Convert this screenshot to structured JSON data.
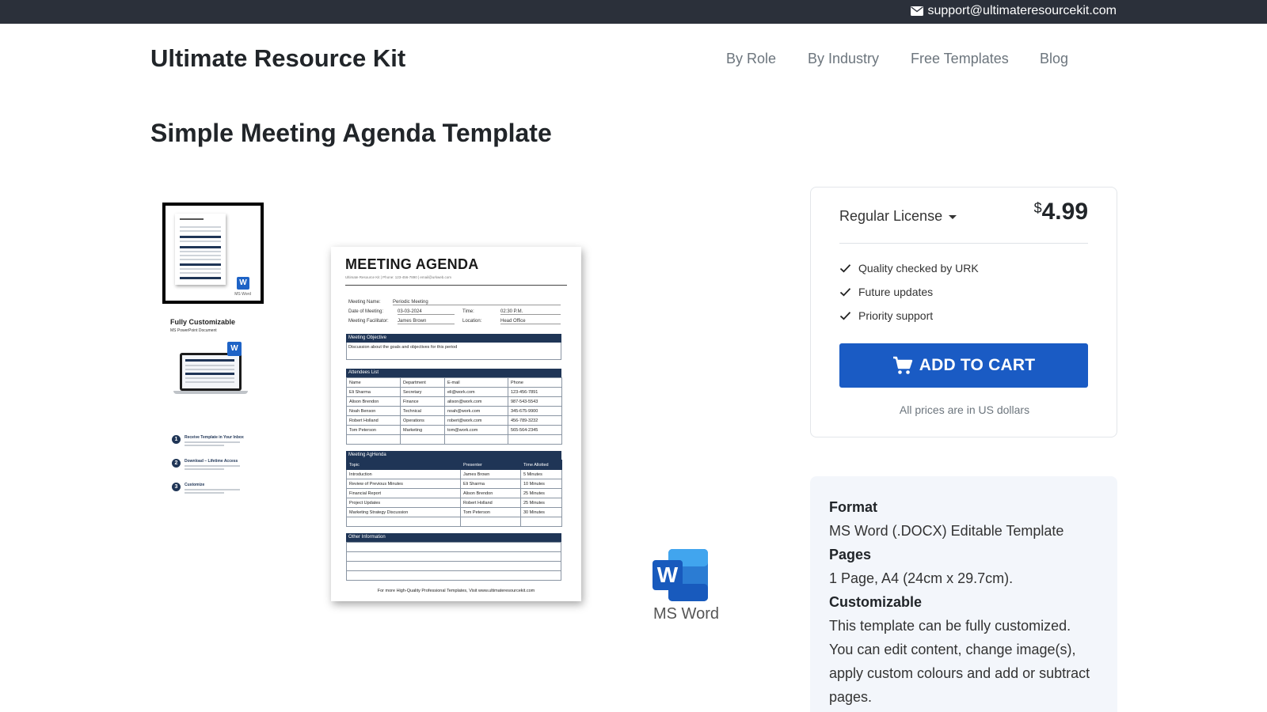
{
  "topbar": {
    "email": "support@ultimateresourcekit.com",
    "icon": "envelope-icon"
  },
  "header": {
    "brand": "Ultimate Resource Kit",
    "nav": [
      "By Role",
      "By Industry",
      "Free Templates",
      "Blog"
    ]
  },
  "page": {
    "title": "Simple Meeting Agenda Template"
  },
  "thumbnails": {
    "active_index": 0,
    "thumb2_title": "Fully Customizable",
    "thumb2_subtitle": "MS PowerPoint Document",
    "thumb1_word_label": "MS Word",
    "steps": [
      {
        "num": "1",
        "title": "Receive Template in Your Inbox"
      },
      {
        "num": "2",
        "title": "Download – Lifetime Access"
      },
      {
        "num": "3",
        "title": "Customize"
      }
    ]
  },
  "document": {
    "title": "MEETING AGENDA",
    "subtitle": "Ultimate Resource Kit | Phone: 123-456-7890 | email@urkweb.com",
    "info": {
      "name_label": "Meeting Name:",
      "name_value": "Periodic Meeting",
      "date_label": "Date of Meeting:",
      "date_value": "03-03-2024",
      "time_label": "Time:",
      "time_value": "02:30 P.M.",
      "facilitator_label": "Meeting Facilitator:",
      "facilitator_value": "James Brown",
      "location_label": "Location:",
      "location_value": "Head Office"
    },
    "objective": {
      "heading": "Meeting Objective",
      "text": "Discussion about the goals and objectives for this period"
    },
    "attendees": {
      "heading": "Attendees List",
      "columns": [
        "Name",
        "Department",
        "E-mail",
        "Phone"
      ],
      "rows": [
        [
          "Eli Sharma",
          "Secretary",
          "eli@work.com",
          "123-456-7891"
        ],
        [
          "Alison Brendon",
          "Finance",
          "alison@work.com",
          "987-543-5543"
        ],
        [
          "Noah Benson",
          "Technical",
          "noah@work.com",
          "345-675-9900"
        ],
        [
          "Robert Holland",
          "Operations",
          "robert@work.com",
          "456-789-3232"
        ],
        [
          "Tom Peterson",
          "Marketing",
          "tom@work.com",
          "565-564-2345"
        ],
        [
          "",
          "",
          "",
          ""
        ]
      ]
    },
    "agenda": {
      "heading": "Meeting AgHenda",
      "columns": [
        "Topic",
        "Presenter",
        "Time Allotted"
      ],
      "rows": [
        [
          "Introduction",
          "James Brown",
          "5 Minutes"
        ],
        [
          "Review of Previous Minutes",
          "Eli Sharma",
          "10 Minutes"
        ],
        [
          "Financial Report",
          "Alison Brendon",
          "25 Minutes"
        ],
        [
          "Project Updates",
          "Robert Holland",
          "25 Minutes"
        ],
        [
          "Marketing Strategy Discussion",
          "Tom Peterson",
          "30 Minutes"
        ],
        [
          "",
          "",
          ""
        ]
      ]
    },
    "other": {
      "heading": "Other Information"
    },
    "footer": "For more High-Quality Professional Templates, Visit www.ultimateresourcekit.com"
  },
  "word_badge": {
    "letter": "W",
    "label": "MS Word"
  },
  "purchase": {
    "license": "Regular License",
    "currency": "$",
    "price": "4.99",
    "features": [
      "Quality checked by URK",
      "Future updates",
      "Priority support"
    ],
    "button": "ADD TO CART",
    "note": "All prices are in US dollars",
    "accent_color": "#1a5bc4"
  },
  "specs": [
    {
      "label": "Format",
      "value": "MS Word (.DOCX) Editable Template"
    },
    {
      "label": "Pages",
      "value": "1 Page, A4 (24cm x 29.7cm)."
    },
    {
      "label": "Customizable",
      "value_lines": [
        "This template can be fully customized.",
        "You can edit content, change image(s),",
        "apply custom colours and add or subtract",
        "pages."
      ]
    }
  ]
}
